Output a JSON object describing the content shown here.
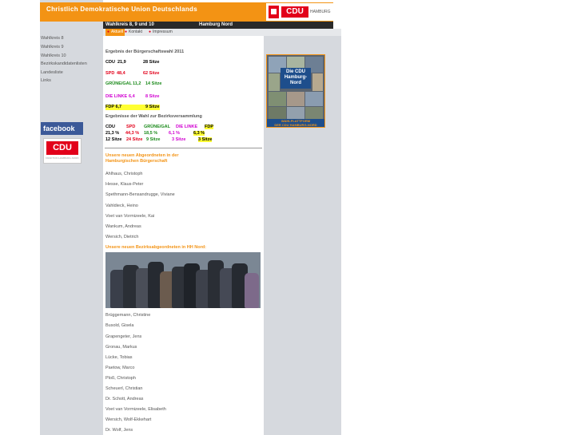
{
  "header": {
    "title": "Christlich Demokratische Union Deutschlands",
    "logo_text": "CDU",
    "logo_city": "HAMBURG",
    "strip_left": "Wahlkreis 8, 9 und 10",
    "strip_right": "Hamburg Nord"
  },
  "nav": {
    "items": [
      "Aktuell",
      "Kontakt",
      "Impressum"
    ]
  },
  "sidebar": {
    "links": [
      "Wahlkreis 8",
      "Wahlkreis 9",
      "Wahlkreis 10",
      "Bezirkskandidatenlisten",
      "Landesliste",
      "Links"
    ],
    "facebook": "facebook",
    "badge_logo": "CDU",
    "badge_sub": "FRAKTION HAMBURG-NORD"
  },
  "results": {
    "heading": "Ergebnis der Bürgerschaftswahl 2011",
    "rows": [
      {
        "party": "CDU",
        "pct": "21,9",
        "seats": "28 Sitze",
        "color": "#000000"
      },
      {
        "party": "SPD",
        "pct": "48,4",
        "seats": "62 Sitze",
        "color": "#e2001a"
      },
      {
        "party": "GRÜNE/GAL",
        "pct": "11,2",
        "seats": "14 Sitze",
        "color": "#1a8a1a"
      },
      {
        "party": "DIE LINKE",
        "pct": "6,4",
        "seats": "8 Sitze",
        "color": "#d100d1"
      },
      {
        "party": "FDP",
        "pct": "6,7",
        "seats": "9 Sitze",
        "color": "#000000"
      }
    ],
    "bv_heading": "Ergebnisse der Wahl zur Bezirksversammlung",
    "bv_parties": [
      "CDU",
      "SPD",
      "GRÜNE/GAL",
      "DIE LINKE",
      "FDP"
    ],
    "bv_pcts": [
      "21,3 %",
      "44,3 %",
      "18,5 %",
      "6,1 %",
      "6,3 %"
    ],
    "bv_seats": [
      "12 Sitze",
      "24 Sitze",
      "9 Sitze",
      "3 Sitze",
      "3 Sitze"
    ]
  },
  "abgeordnete": {
    "heading_line1": "Unsere neuen Abgeordneten in der",
    "heading_line2": "Hamburgischen Bürgerschaft",
    "members": [
      "Ahlhaus, Christoph",
      "Hesse, Klaus-Peter",
      "Spethmann-Bensandrugge, Viviane",
      "Vahldieck, Heino",
      "Voet van Vormizeele, Kai",
      "Wankum, Andreas",
      "Wersich, Dietrich"
    ]
  },
  "bezirk": {
    "heading": "Unsere neuen Bezirksabgeordneten in HH Nord:",
    "members": [
      "Brüggemann, Christine",
      "Busold, Gisela",
      "Grapengeter, Jens",
      "Gronau, Markus",
      "Lücke, Tobias",
      "Paetow, Marco",
      "Ploß, Christoph",
      "Scheuerl, Christian",
      "Dr. Schott, Andreas",
      "Voet van Vormizeele, Elisabeth",
      "Wersich, Wolf-Ekkehart",
      "Dr. Wolf, Jens"
    ]
  },
  "promo": {
    "line1": "Die CDU",
    "line2": "Hamburg-",
    "line3": "Nord",
    "foot1": "WAHLPLATTFORM",
    "foot2": "DER CDU HAMBURG-NORD"
  }
}
